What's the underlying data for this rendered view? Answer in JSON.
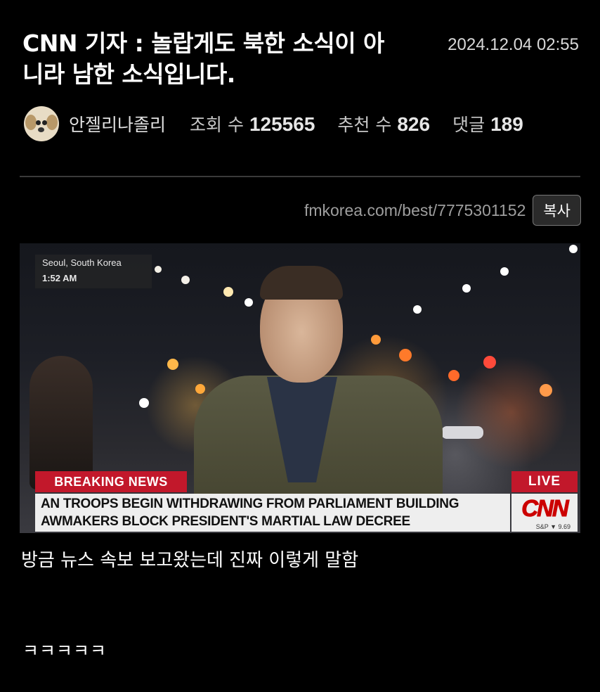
{
  "post": {
    "title": "CNN 기자 : 놀랍게도 북한 소식이 아니라 남한 소식입니다.",
    "date": "2024.12.04 02:55",
    "author": "안젤리나졸리",
    "views_label": "조회 수",
    "views": "125565",
    "recommend_label": "추천 수",
    "recommend": "826",
    "comments_label": "댓글",
    "comments": "189",
    "url": "fmkorea.com/best/7775301152",
    "copy_label": "복사",
    "caption": "방금 뉴스 속보 보고왔는데 진짜 이렇게 말함",
    "laugh": "ㅋㅋㅋㅋㅋ"
  },
  "video": {
    "location": "Seoul, South Korea",
    "time": "1:52 AM",
    "breaking": "BREAKING NEWS",
    "live": "LIVE",
    "ticker_line1": "AN TROOPS BEGIN WITHDRAWING FROM PARLIAMENT BUILDING",
    "ticker_line2": "AWMAKERS BLOCK PRESIDENT'S MARTIAL LAW DECREE",
    "logo": "CNN",
    "stock": "S&P ▼ 9.69"
  },
  "colors": {
    "background": "#000000",
    "breaking_red": "#c2182b",
    "cnn_red": "#cc0000"
  }
}
